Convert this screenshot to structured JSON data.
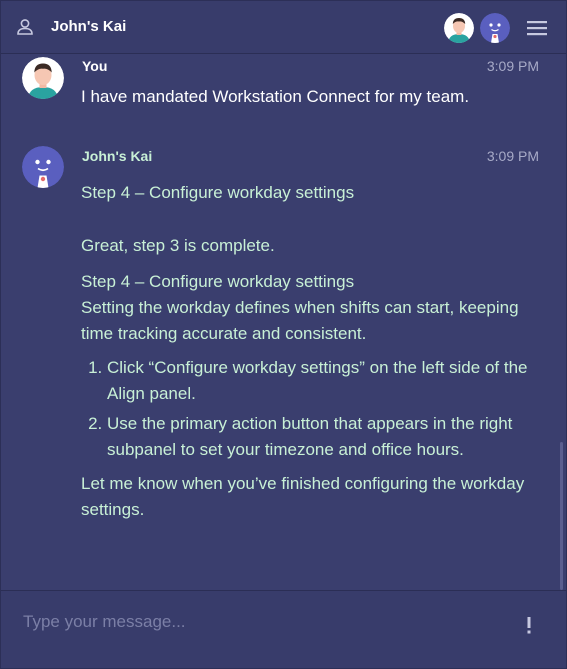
{
  "header": {
    "title": "John's Kai"
  },
  "messages": [
    {
      "sender": "You",
      "time": "3:09 PM",
      "text": "I have mandated Workstation Connect for my team."
    },
    {
      "sender": "John's Kai",
      "time": "3:09 PM",
      "title": "Step 4 – Configure workday settings",
      "intro": "Great, step 3 is complete.",
      "heading": "Step 4 – Configure workday settings",
      "description": "Setting the workday defines when shifts can start, keeping time tracking accurate and consistent.",
      "steps": [
        "Click “Configure workday settings” on the left side of the Align panel.",
        "Use the primary action button that appears in the right subpanel to set your timezone and office hours."
      ],
      "outro": "Let me know when you’ve finished configuring the workday settings."
    }
  ],
  "composer": {
    "placeholder": "Type your message..."
  },
  "colors": {
    "background": "#3a3e6e",
    "bot_text": "#c8f0d6",
    "timestamp": "#a7aac7"
  }
}
